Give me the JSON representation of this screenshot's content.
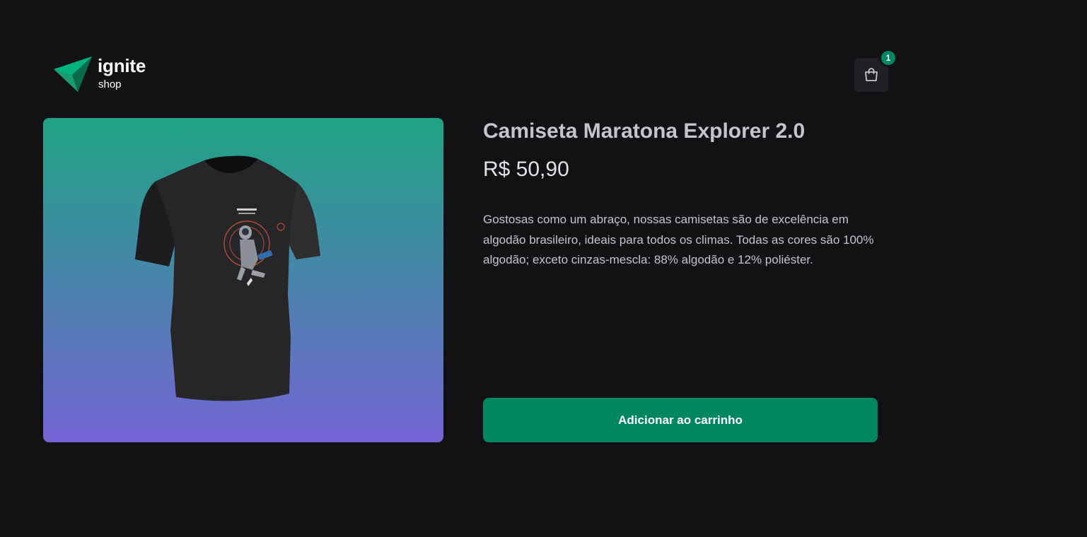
{
  "brand": {
    "name": "ignite",
    "sub": "shop",
    "logo_icon": "ignite-triangle-logo",
    "accent_color": "#00875f",
    "gradient_top": "#1ea483",
    "gradient_bottom": "#7465d4"
  },
  "header": {
    "cart_icon": "shopping-bag-icon",
    "cart_count": "1"
  },
  "product": {
    "image_icon": "black-tshirt-astronaut-print",
    "title": "Camiseta Maratona Explorer 2.0",
    "price": "R$ 50,90",
    "description": "Gostosas como um abraço, nossas camisetas são de excelência em algodão brasileiro, ideais para todos os climas. Todas as cores são 100% algodão; exceto cinzas-mescla: 88% algodão e 12% poliéster.",
    "add_to_cart_label": "Adicionar ao carrinho"
  }
}
